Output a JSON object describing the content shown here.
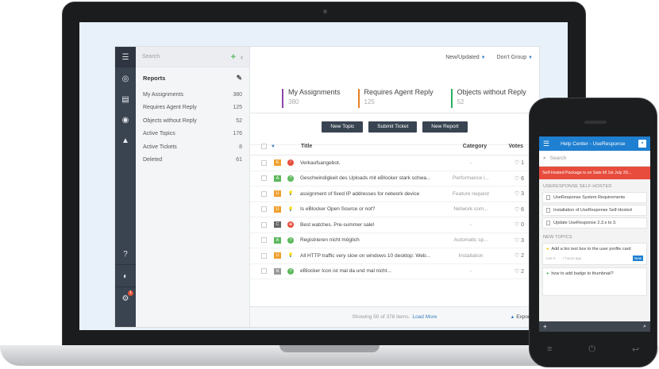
{
  "app": {
    "search_placeholder": "Search",
    "reports_title": "Reports",
    "reports": [
      {
        "label": "My Assignments",
        "count": "380"
      },
      {
        "label": "Requires Agent Reply",
        "count": "125"
      },
      {
        "label": "Objects without Reply",
        "count": "52"
      },
      {
        "label": "Active Topics",
        "count": "176"
      },
      {
        "label": "Active Tickets",
        "count": "8"
      },
      {
        "label": "Deleted",
        "count": "61"
      }
    ],
    "sort_label": "New/Updated",
    "group_label": "Don't Group",
    "stats": [
      {
        "label": "My Assignments",
        "value": "380",
        "color": "#8e44ad"
      },
      {
        "label": "Requires Agent Reply",
        "value": "125",
        "color": "#e67e22"
      },
      {
        "label": "Objects without Reply",
        "value": "52",
        "color": "#27ae60"
      }
    ],
    "buttons": [
      "New Topic",
      "Submit Ticket",
      "New Report"
    ],
    "columns": {
      "title": "Title",
      "category": "Category",
      "votes": "Votes"
    },
    "rows": [
      {
        "tag": "K",
        "tag_color": "#f0a030",
        "status": "!",
        "status_color": "#e74c3c",
        "title": "Verkaufsangebot.",
        "category": "-",
        "votes": "1"
      },
      {
        "tag": "A",
        "tag_color": "#5cb85c",
        "status": "?",
        "status_color": "#5cb85c",
        "title": "Geschwindigkeit des Uploads mit eBlocker stark schwa...",
        "category": "Performance i...",
        "votes": "6"
      },
      {
        "tag": "U",
        "tag_color": "#f0a030",
        "status": "💡",
        "status_color": "#f1c40f",
        "title": "assignment of fixed IP addresses for network device",
        "category": "Feature request",
        "votes": "3"
      },
      {
        "tag": "U",
        "tag_color": "#f0a030",
        "status": "💡",
        "status_color": "#f1c40f",
        "title": "Is eBlocker Open Source or not?",
        "category": "Network com...",
        "votes": "6"
      },
      {
        "tag": "C",
        "tag_color": "#666666",
        "status": "⊕",
        "status_color": "#e74c3c",
        "title": "Best watches. Pre-summer sale!",
        "category": "-",
        "votes": "0"
      },
      {
        "tag": "A",
        "tag_color": "#5cb85c",
        "status": "?",
        "status_color": "#5cb85c",
        "title": "Registrieren nicht möglich",
        "category": "Automatic sp...",
        "votes": "3"
      },
      {
        "tag": "U",
        "tag_color": "#f0a030",
        "status": "💡",
        "status_color": "#f1c40f",
        "title": "All HTTP traffic very slow on windows 10 desktop: Web...",
        "category": "Installation",
        "votes": "2"
      },
      {
        "tag": "N",
        "tag_color": "#999999",
        "status": "?",
        "status_color": "#5cb85c",
        "title": "eBlocker Icon ist mal da und mal nicht...",
        "category": "-",
        "votes": "2"
      }
    ],
    "footer_text": "Showing 50 of 378 items.",
    "load_more": "Load More",
    "export": "Export"
  },
  "phone": {
    "title": "Help Center - UseResponse",
    "search_placeholder": "Search",
    "promo": "Self-Hosted Package is on Sale till 1st July 20...",
    "section1": "USERESPONSE SELF-HOSTED",
    "docs": [
      "UseResponse System Requirements",
      "Installation of UseResponse Self-Hosted",
      "Update UseResponse 2.3.x to 3."
    ],
    "section2": "NEW TOPICS",
    "card1": {
      "q": "Add a bio text box to the user profile card",
      "author": "Lee K.",
      "time": "7 hours ago",
      "badge": "New"
    },
    "card2": {
      "q": "how to add badge to thumbnail?"
    }
  }
}
